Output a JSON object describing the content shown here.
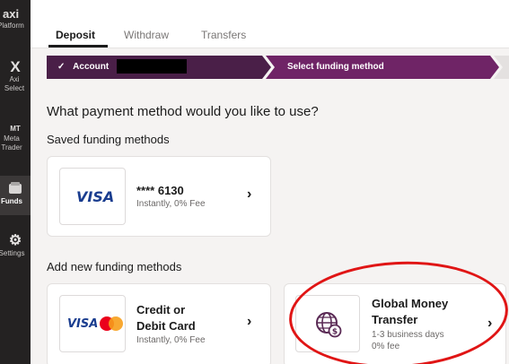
{
  "rail": {
    "logo": {
      "glyph": "axi",
      "label": "Platform"
    },
    "axiselect": {
      "glyph": "X",
      "label": "Axi Select"
    },
    "metatrader": {
      "glyph": "MT",
      "label": "Meta Trader"
    },
    "funds": {
      "glyph": "▤",
      "label": "Funds"
    },
    "settings": {
      "glyph": "⚙",
      "label": "Settings"
    }
  },
  "tabs": [
    {
      "label": "Deposit",
      "active": true
    },
    {
      "label": "Withdraw",
      "active": false
    },
    {
      "label": "Transfers",
      "active": false
    }
  ],
  "stepper": {
    "done_check": "✓",
    "done_label": "Account",
    "current_label": "Select funding method"
  },
  "heading": "What payment method would you like to use?",
  "saved": {
    "title": "Saved funding methods",
    "card": {
      "brand": "VISA",
      "number": "**** 6130",
      "detail": "Instantly, 0% Fee",
      "chevron": "›"
    }
  },
  "new": {
    "title": "Add new funding methods",
    "card_credit": {
      "brand": "VISA",
      "title_line1": "Credit or",
      "title_line2": "Debit Card",
      "detail": "Instantly, 0% Fee",
      "chevron": "›"
    },
    "card_transfer": {
      "title_line1": "Global Money",
      "title_line2": "Transfer",
      "detail1": "1-3 business days",
      "detail2": "0% fee",
      "chevron": "›"
    }
  },
  "colors": {
    "stepper_done": "#4a1f48",
    "stepper_current": "#6f2466",
    "annotation_circle": "#e01515",
    "globe_icon": "#5a2a55"
  },
  "icons": [
    "check-icon",
    "chevron-right-icon",
    "globe-money-icon",
    "gear-icon",
    "axi-logo-icon"
  ]
}
